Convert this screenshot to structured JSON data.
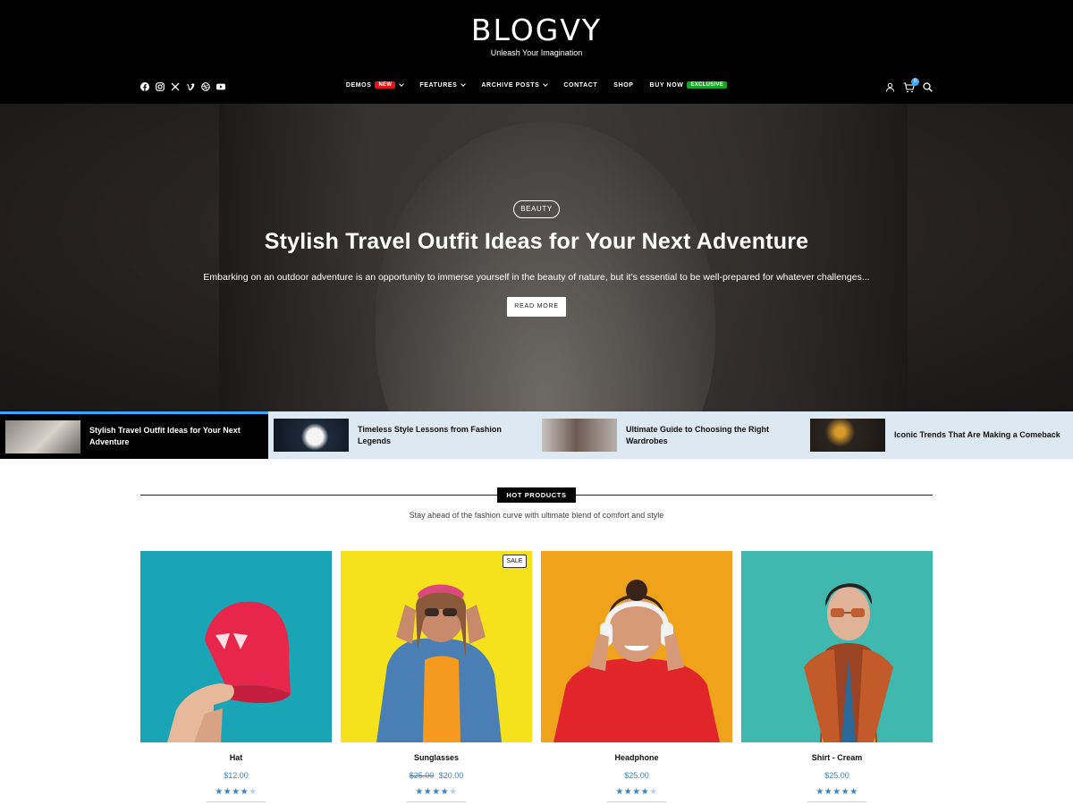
{
  "site": {
    "title": "BLOGVY",
    "tagline": "Unleash Your Imagination"
  },
  "social_icons": [
    "facebook-icon",
    "instagram-icon",
    "x-icon",
    "vimeo-icon",
    "dribbble-icon",
    "youtube-icon"
  ],
  "nav": {
    "items": [
      {
        "label": "DEMOS",
        "badge": "NEW",
        "badge_color": "#e41515",
        "has_dropdown": true
      },
      {
        "label": "FEATURES",
        "has_dropdown": true
      },
      {
        "label": "ARCHIVE POSTS",
        "has_dropdown": true
      },
      {
        "label": "CONTACT"
      },
      {
        "label": "SHOP"
      },
      {
        "label": "BUY NOW",
        "badge": "EXCLUSIVE",
        "badge_color": "#15a520"
      }
    ]
  },
  "header_icons": {
    "user": "user-icon",
    "cart": "cart-icon",
    "cart_count": "0",
    "search": "search-icon"
  },
  "hero": {
    "category": "BEAUTY",
    "title": "Stylish Travel Outfit Ideas for Your Next Adventure",
    "excerpt": "Embarking on an outdoor adventure is an opportunity to immerse yourself in the beauty of nature, but it’s essential to be well-prepared for whatever challenges...",
    "button": "READ MORE"
  },
  "slider": [
    {
      "title": "Stylish Travel Outfit Ideas for Your Next Adventure",
      "active": true
    },
    {
      "title": "Timeless Style Lessons from Fashion Legends"
    },
    {
      "title": "Ultimate Guide to Choosing the Right Wardrobes"
    },
    {
      "title": "Iconic Trends That Are Making a Comeback"
    }
  ],
  "hot_products": {
    "label": "HOT PRODUCTS",
    "subtitle": "Stay ahead of the fashion curve with ultimate blend of comfort and style",
    "products": [
      {
        "name": "Hat",
        "price": "$12.00",
        "old_price": "",
        "rating": 4.5,
        "sale": ""
      },
      {
        "name": "Sunglasses",
        "price": "$20.00",
        "old_price": "$25.00",
        "rating": 4,
        "sale": "SALE"
      },
      {
        "name": "Headphone",
        "price": "$25.00",
        "old_price": "",
        "rating": 4,
        "sale": ""
      },
      {
        "name": "Shirt - Cream",
        "price": "$25.00",
        "old_price": "",
        "rating": 5,
        "sale": ""
      }
    ]
  },
  "colors": {
    "header_bg": "#000000",
    "accent_blue": "#3ba7ff",
    "price_blue": "#3b82c4",
    "badge_new": "#e41515",
    "badge_exclusive": "#15a520",
    "strip_bg": "#dce8f2"
  }
}
